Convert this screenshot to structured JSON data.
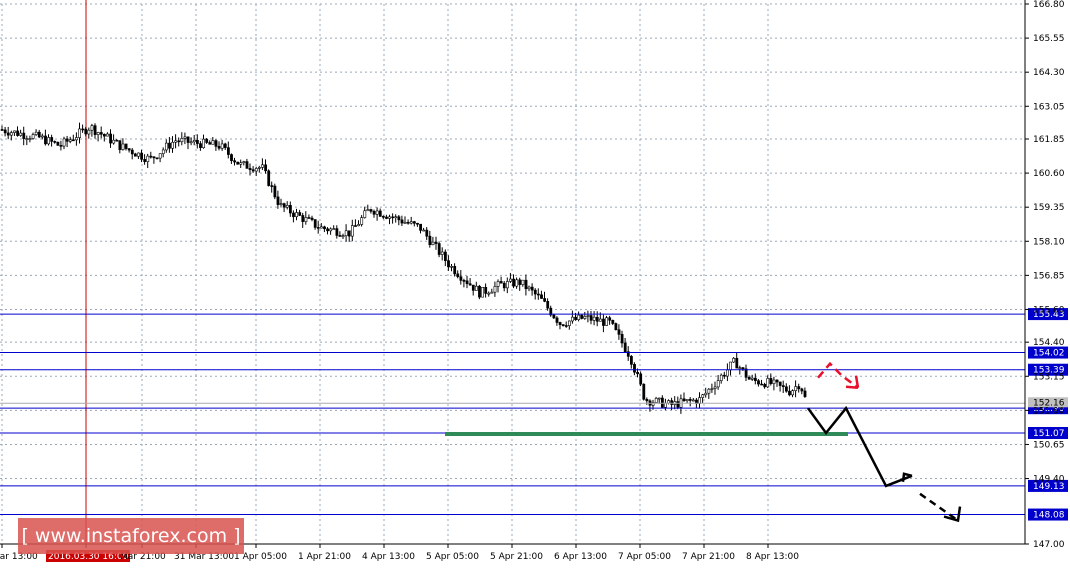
{
  "chart_data": {
    "type": "candlestick",
    "y_axis_ticks": [
      "166.80",
      "165.55",
      "164.30",
      "163.05",
      "161.85",
      "160.60",
      "159.35",
      "158.10",
      "156.85",
      "155.60",
      "154.40",
      "153.15",
      "151.90",
      "150.65",
      "149.40",
      "147.00"
    ],
    "x_axis_ticks": [
      "Mar 13:00",
      "2016.03.30 16:00",
      "Mar 21:00",
      "31 Mar 13:00",
      "1 Apr 05:00",
      "1 Apr 21:00",
      "4 Apr 13:00",
      "5 Apr 05:00",
      "5 Apr 21:00",
      "6 Apr 13:00",
      "7 Apr 05:00",
      "7 Apr 21:00",
      "8 Apr 13:00"
    ],
    "highlighted_x_label": "2016.03.30 16:00",
    "price_levels": [
      {
        "value": 155.43,
        "label": "155.43"
      },
      {
        "value": 154.02,
        "label": "154.02"
      },
      {
        "value": 153.39,
        "label": "153.39"
      },
      {
        "value": 151.98,
        "label": "151.98"
      },
      {
        "value": 151.07,
        "label": "151.07"
      },
      {
        "value": 149.13,
        "label": "149.13"
      },
      {
        "value": 148.08,
        "label": "148.08"
      }
    ],
    "current_price_label": "152.16",
    "support_zone": {
      "value": 151.07,
      "color": "#2e8b57"
    },
    "forecast_path": [
      153.39,
      151.98,
      151.07,
      151.98,
      149.13,
      149.5,
      148.08
    ],
    "ylim": [
      147.0,
      166.8
    ],
    "grid": true,
    "colors": {
      "level_line": "#0000cc",
      "vertical_marker": "#cc0000",
      "candles": "#000000",
      "alt_arrow": "#e8102a",
      "label_bg": "#0000cc",
      "x_highlight_bg": "#cc0000"
    }
  },
  "watermark": {
    "text": "[  www.instaforex.com  ]"
  }
}
